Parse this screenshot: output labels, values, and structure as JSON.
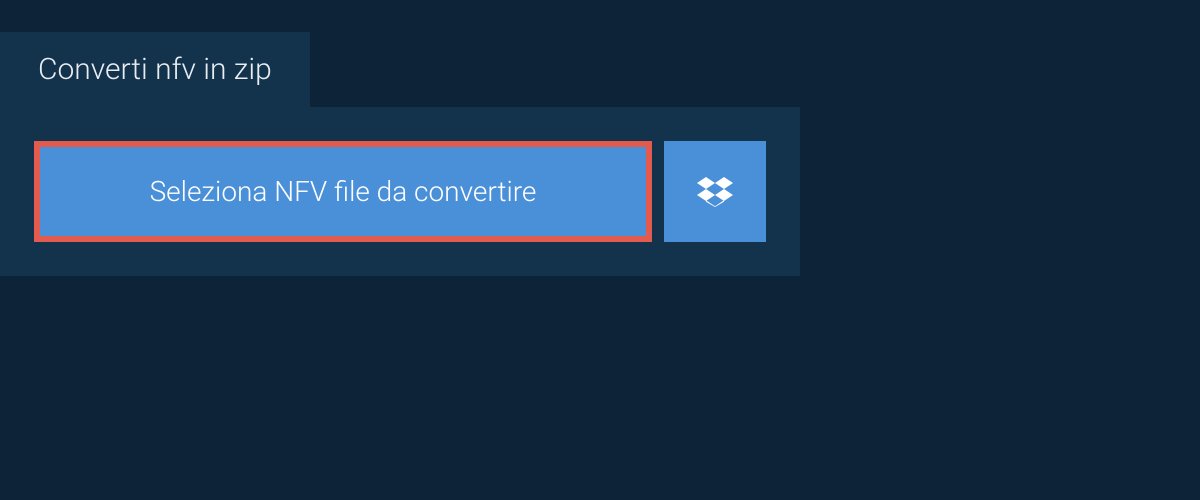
{
  "tab": {
    "label": "Converti nfv in zip"
  },
  "panel": {
    "file_button_label": "Seleziona NFV file da convertire"
  }
}
